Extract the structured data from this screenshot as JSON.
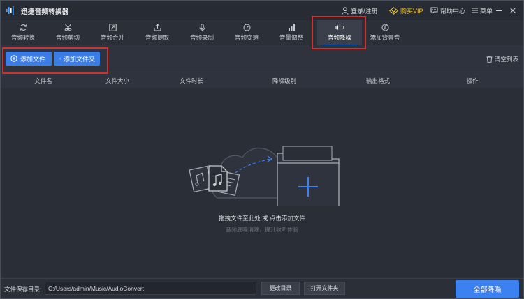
{
  "app": {
    "title": "迅捷音频转换器"
  },
  "titlebar": {
    "login": "登录/注册",
    "vip": "购买VIP",
    "help": "帮助中心",
    "menu": "菜单"
  },
  "tabs": [
    {
      "label": "音频转换",
      "icon": "refresh-icon"
    },
    {
      "label": "音频剪切",
      "icon": "scissors-icon"
    },
    {
      "label": "音频合并",
      "icon": "merge-icon"
    },
    {
      "label": "音频提取",
      "icon": "extract-icon"
    },
    {
      "label": "音频录制",
      "icon": "microphone-icon"
    },
    {
      "label": "音频变速",
      "icon": "speed-icon"
    },
    {
      "label": "音量调整",
      "icon": "volume-icon"
    },
    {
      "label": "音频降噪",
      "icon": "waveform-icon",
      "active": true
    },
    {
      "label": "添加背景音",
      "icon": "music-disc-icon"
    }
  ],
  "actions": {
    "add_file": "添加文件",
    "add_folder": "添加文件夹",
    "clear_list": "清空列表"
  },
  "table": {
    "columns": [
      "文件名",
      "文件大小",
      "文件时长",
      "降噪级别",
      "输出格式",
      "操作"
    ]
  },
  "empty": {
    "main": "拖拽文件至此处 或 点击添加文件",
    "sub": "音频底噪消除，提升收听体验"
  },
  "footer": {
    "save_label": "文件保存目录:",
    "save_path": "C:/Users/admin/Music/AudioConvert",
    "change_dir": "更改目录",
    "open_folder": "打开文件夹",
    "run_all": "全部降噪"
  },
  "colors": {
    "accent": "#3b82f0",
    "vip": "#f0c22a",
    "highlight": "#d0312d",
    "background": "#2a2e37"
  }
}
